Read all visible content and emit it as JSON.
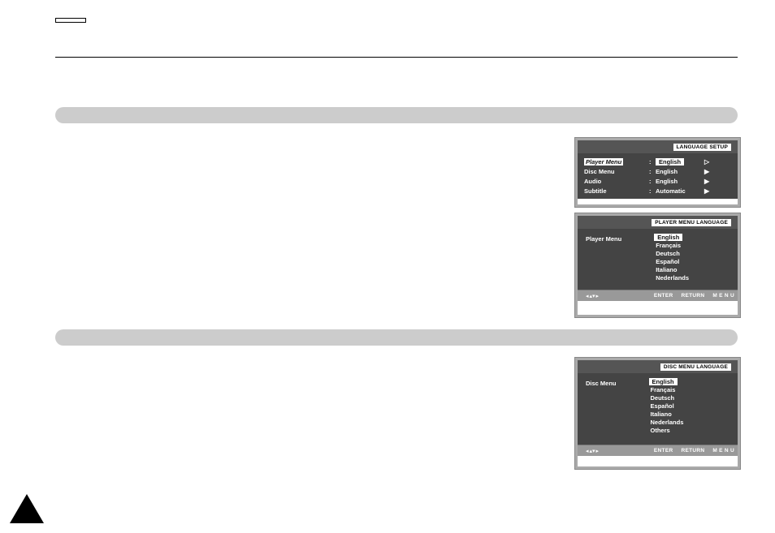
{
  "page_tab": " ",
  "osd1": {
    "title": "LANGUAGE SETUP",
    "rows": [
      {
        "label": "Player Menu",
        "value": "English",
        "highlight": true
      },
      {
        "label": "Disc Menu",
        "value": "English",
        "highlight": false
      },
      {
        "label": "Audio",
        "value": "English",
        "highlight": false
      },
      {
        "label": "Subtitle",
        "value": "Automatic",
        "highlight": false
      }
    ]
  },
  "osd2": {
    "title": "PLAYER MENU LANGUAGE",
    "label": "Player Menu",
    "options": [
      "English",
      "Français",
      "Deutsch",
      "Español",
      "Italiano",
      "Nederlands"
    ],
    "selected": "English",
    "footer": {
      "enter": "ENTER",
      "return": "RETURN",
      "menu": "M E N U"
    }
  },
  "osd3": {
    "title": "DISC MENU LANGUAGE",
    "label": "Disc Menu",
    "options": [
      "English",
      "Français",
      "Deutsch",
      "Español",
      "Italiano",
      "Nederlands",
      "Others"
    ],
    "selected": "English",
    "footer": {
      "enter": "ENTER",
      "return": "RETURN",
      "menu": "M E N U"
    }
  }
}
